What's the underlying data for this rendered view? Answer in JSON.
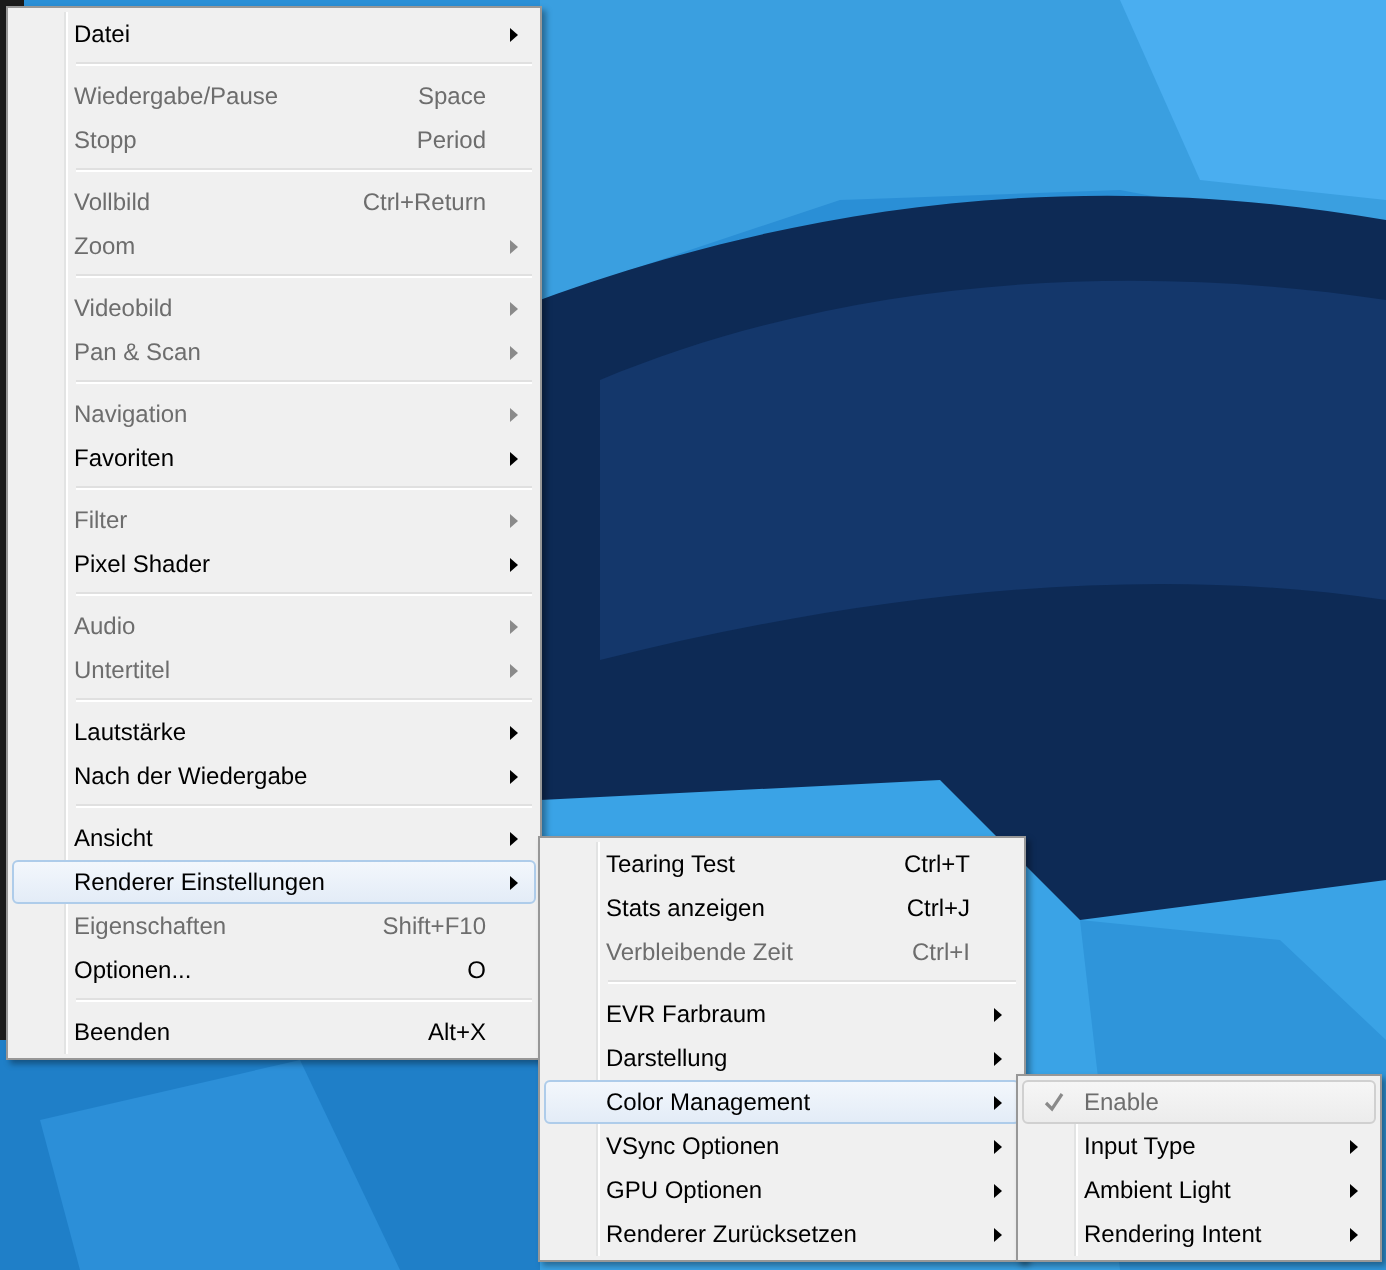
{
  "menus": [
    {
      "items": [
        {
          "kind": "item",
          "label": "Datei",
          "disabled": false,
          "has_submenu": true,
          "selected": false
        },
        {
          "kind": "separator"
        },
        {
          "kind": "item",
          "label": "Wiedergabe/Pause",
          "shortcut": "Space",
          "disabled": true,
          "has_submenu": false,
          "selected": false
        },
        {
          "kind": "item",
          "label": "Stopp",
          "shortcut": "Period",
          "disabled": true,
          "has_submenu": false,
          "selected": false
        },
        {
          "kind": "separator"
        },
        {
          "kind": "item",
          "label": "Vollbild",
          "shortcut": "Ctrl+Return",
          "disabled": true,
          "has_submenu": false,
          "selected": false
        },
        {
          "kind": "item",
          "label": "Zoom",
          "disabled": true,
          "has_submenu": true,
          "selected": false
        },
        {
          "kind": "separator"
        },
        {
          "kind": "item",
          "label": "Videobild",
          "disabled": true,
          "has_submenu": true,
          "selected": false
        },
        {
          "kind": "item",
          "label": "Pan & Scan",
          "disabled": true,
          "has_submenu": true,
          "selected": false
        },
        {
          "kind": "separator"
        },
        {
          "kind": "item",
          "label": "Navigation",
          "disabled": true,
          "has_submenu": true,
          "selected": false
        },
        {
          "kind": "item",
          "label": "Favoriten",
          "disabled": false,
          "has_submenu": true,
          "selected": false
        },
        {
          "kind": "separator"
        },
        {
          "kind": "item",
          "label": "Filter",
          "disabled": true,
          "has_submenu": true,
          "selected": false
        },
        {
          "kind": "item",
          "label": "Pixel Shader",
          "disabled": false,
          "has_submenu": true,
          "selected": false
        },
        {
          "kind": "separator"
        },
        {
          "kind": "item",
          "label": "Audio",
          "disabled": true,
          "has_submenu": true,
          "selected": false
        },
        {
          "kind": "item",
          "label": "Untertitel",
          "disabled": true,
          "has_submenu": true,
          "selected": false
        },
        {
          "kind": "separator"
        },
        {
          "kind": "item",
          "label": "Lautstärke",
          "disabled": false,
          "has_submenu": true,
          "selected": false
        },
        {
          "kind": "item",
          "label": "Nach der Wiedergabe",
          "disabled": false,
          "has_submenu": true,
          "selected": false
        },
        {
          "kind": "separator"
        },
        {
          "kind": "item",
          "label": "Ansicht",
          "disabled": false,
          "has_submenu": true,
          "selected": false
        },
        {
          "kind": "item",
          "label": "Renderer Einstellungen",
          "disabled": false,
          "has_submenu": true,
          "selected": true
        },
        {
          "kind": "item",
          "label": "Eigenschaften",
          "shortcut": "Shift+F10",
          "disabled": true,
          "has_submenu": false,
          "selected": false
        },
        {
          "kind": "item",
          "label": "Optionen...",
          "shortcut": "O",
          "disabled": false,
          "has_submenu": false,
          "selected": false
        },
        {
          "kind": "separator"
        },
        {
          "kind": "item",
          "label": "Beenden",
          "shortcut": "Alt+X",
          "disabled": false,
          "has_submenu": false,
          "selected": false
        }
      ]
    },
    {
      "items": [
        {
          "kind": "item",
          "label": "Tearing Test",
          "shortcut": "Ctrl+T",
          "disabled": false,
          "has_submenu": false,
          "selected": false
        },
        {
          "kind": "item",
          "label": "Stats anzeigen",
          "shortcut": "Ctrl+J",
          "disabled": false,
          "has_submenu": false,
          "selected": false
        },
        {
          "kind": "item",
          "label": "Verbleibende Zeit",
          "shortcut": "Ctrl+I",
          "disabled": true,
          "has_submenu": false,
          "selected": false
        },
        {
          "kind": "separator"
        },
        {
          "kind": "item",
          "label": "EVR Farbraum",
          "disabled": false,
          "has_submenu": true,
          "selected": false
        },
        {
          "kind": "item",
          "label": "Darstellung",
          "disabled": false,
          "has_submenu": true,
          "selected": false
        },
        {
          "kind": "item",
          "label": "Color Management",
          "disabled": false,
          "has_submenu": true,
          "selected": true
        },
        {
          "kind": "item",
          "label": "VSync Optionen",
          "disabled": false,
          "has_submenu": true,
          "selected": false
        },
        {
          "kind": "item",
          "label": "GPU Optionen",
          "disabled": false,
          "has_submenu": true,
          "selected": false
        },
        {
          "kind": "item",
          "label": "Renderer Zurücksetzen",
          "disabled": false,
          "has_submenu": true,
          "selected": false
        }
      ]
    },
    {
      "items": [
        {
          "kind": "item",
          "label": "Enable",
          "disabled": true,
          "has_submenu": false,
          "selected": true,
          "checked": true
        },
        {
          "kind": "item",
          "label": "Input Type",
          "disabled": false,
          "has_submenu": true,
          "selected": false,
          "checked": false
        },
        {
          "kind": "item",
          "label": "Ambient Light",
          "disabled": false,
          "has_submenu": true,
          "selected": false,
          "checked": false
        },
        {
          "kind": "item",
          "label": "Rendering Intent",
          "disabled": false,
          "has_submenu": true,
          "selected": false,
          "checked": false
        }
      ]
    }
  ]
}
